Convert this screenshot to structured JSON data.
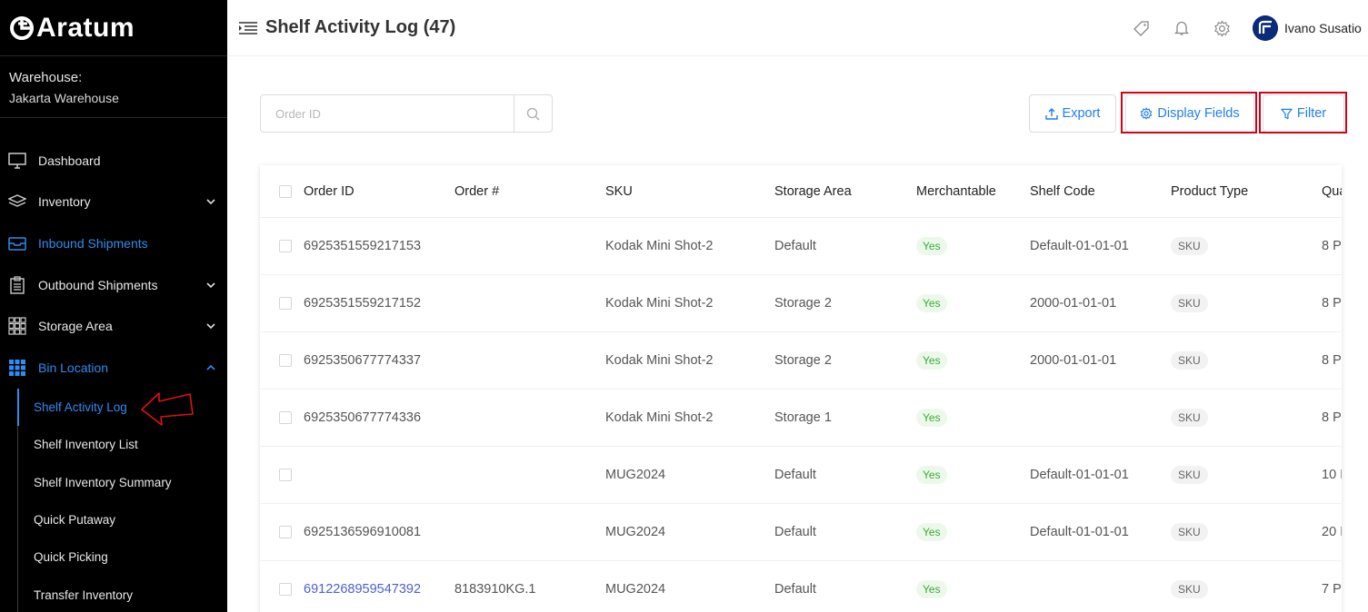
{
  "brand": {
    "name": "Aratum"
  },
  "warehouse": {
    "label": "Warehouse:",
    "name": "Jakarta Warehouse"
  },
  "nav": {
    "items": [
      {
        "label": "Dashboard"
      },
      {
        "label": "Inventory"
      },
      {
        "label": "Inbound Shipments"
      },
      {
        "label": "Outbound Shipments"
      },
      {
        "label": "Storage Area"
      },
      {
        "label": "Bin Location"
      }
    ],
    "sub_items": [
      {
        "label": "Shelf Activity Log"
      },
      {
        "label": "Shelf Inventory List"
      },
      {
        "label": "Shelf Inventory Summary"
      },
      {
        "label": "Quick Putaway"
      },
      {
        "label": "Quick Picking"
      },
      {
        "label": "Transfer Inventory"
      }
    ]
  },
  "header": {
    "title": "Shelf Activity Log (47)",
    "user_name": "Ivano Susatio"
  },
  "toolbar": {
    "search_placeholder": "Order ID",
    "export_label": "Export",
    "display_fields_label": "Display Fields",
    "filter_label": "Filter"
  },
  "table": {
    "columns": [
      "Order ID",
      "Order #",
      "SKU",
      "Storage Area",
      "Merchantable",
      "Shelf Code",
      "Product Type",
      "Qua"
    ],
    "rows": [
      {
        "order_id": "6925351559217153",
        "order_num": "",
        "sku": "Kodak Mini Shot-2",
        "area": "Default",
        "merch": "Yes",
        "shelf": "Default-01-01-01",
        "ptype": "SKU",
        "qty": "8 P"
      },
      {
        "order_id": "6925351559217152",
        "order_num": "",
        "sku": "Kodak Mini Shot-2",
        "area": "Storage 2",
        "merch": "Yes",
        "shelf": "2000-01-01-01",
        "ptype": "SKU",
        "qty": "8 P"
      },
      {
        "order_id": "6925350677774337",
        "order_num": "",
        "sku": "Kodak Mini Shot-2",
        "area": "Storage 2",
        "merch": "Yes",
        "shelf": "2000-01-01-01",
        "ptype": "SKU",
        "qty": "8 P"
      },
      {
        "order_id": "6925350677774336",
        "order_num": "",
        "sku": "Kodak Mini Shot-2",
        "area": "Storage 1",
        "merch": "Yes",
        "shelf": "",
        "ptype": "SKU",
        "qty": "8 P"
      },
      {
        "order_id": "",
        "order_num": "",
        "sku": "MUG2024",
        "area": "Default",
        "merch": "Yes",
        "shelf": "Default-01-01-01",
        "ptype": "SKU",
        "qty": "10 I"
      },
      {
        "order_id": "6925136596910081",
        "order_num": "",
        "sku": "MUG2024",
        "area": "Default",
        "merch": "Yes",
        "shelf": "Default-01-01-01",
        "ptype": "SKU",
        "qty": "20 I"
      },
      {
        "order_id": "6912268959547392",
        "order_num": "8183910KG.1",
        "sku": "MUG2024",
        "area": "Default",
        "merch": "Yes",
        "shelf": "",
        "ptype": "SKU",
        "qty": "7 P"
      }
    ]
  },
  "colors": {
    "accent": "#2f8cf0",
    "link": "#4b5fd6",
    "highlight": "#d0021b",
    "sidebar_bg": "#000000"
  }
}
